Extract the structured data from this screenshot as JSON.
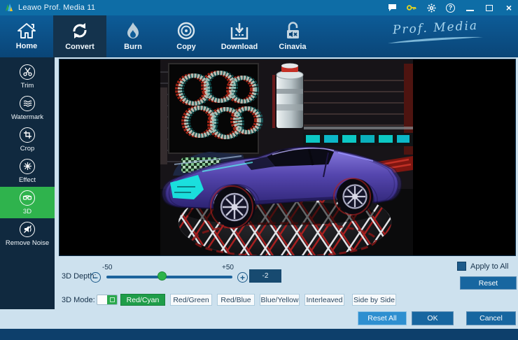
{
  "window": {
    "title": "Leawo Prof. Media 11"
  },
  "titlebar": {
    "icons": [
      "comment-icon",
      "key-icon",
      "gear-icon",
      "help-icon",
      "minimize-icon",
      "maximize-icon",
      "close-icon"
    ],
    "help_glyph": "?",
    "close_glyph": "×"
  },
  "nav": {
    "tabs": [
      {
        "label": "Home",
        "icon": "home-icon"
      },
      {
        "label": "Convert",
        "icon": "convert-icon"
      },
      {
        "label": "Burn",
        "icon": "burn-icon"
      },
      {
        "label": "Copy",
        "icon": "copy-icon"
      },
      {
        "label": "Download",
        "icon": "download-icon"
      },
      {
        "label": "Cinavia",
        "icon": "cinavia-icon"
      }
    ],
    "active_tab": "Convert",
    "brand_script": "Prof. Media"
  },
  "sidebar": {
    "items": [
      {
        "label": "Trim",
        "icon": "scissors-icon"
      },
      {
        "label": "Watermark",
        "icon": "waves-icon"
      },
      {
        "label": "Crop",
        "icon": "crop-icon"
      },
      {
        "label": "Effect",
        "icon": "sparkle-icon"
      },
      {
        "label": "3D",
        "icon": "3d-glasses-icon"
      },
      {
        "label": "Remove Noise",
        "icon": "noise-off-icon"
      }
    ],
    "active_item": "3D"
  },
  "preview": {
    "content": "anaglyph 3D video frame of a purple sports car in a sci-fi garage with ring display, tank and grid floor"
  },
  "depth_control": {
    "label": "3D Depth:",
    "min_label": "-50",
    "max_label": "+50",
    "value": "-2",
    "slider_min": -50,
    "slider_max": 50,
    "slider_value": -2,
    "minus_glyph": "−",
    "plus_glyph": "+"
  },
  "mode_control": {
    "label": "3D Mode:",
    "enabled": true,
    "options": [
      "Red/Cyan",
      "Red/Green",
      "Red/Blue",
      "Blue/Yellow",
      "Interleaved",
      "Side by Side"
    ],
    "selected": "Red/Cyan"
  },
  "apply_to_all": {
    "label": "Apply to All",
    "checked": true
  },
  "buttons": {
    "reset": "Reset",
    "reset_all": "Reset All",
    "ok": "OK",
    "cancel": "Cancel"
  },
  "colors": {
    "titlebar": "#0e6da6",
    "nav_top": "#0d5c98",
    "nav_bottom": "#0a4577",
    "active_tab_bg": "#14334d",
    "sidebar_bg": "#10293f",
    "accent_green": "#2fb34d",
    "panel_bg": "#cde1ee",
    "button_blue": "#1766a0",
    "button_light_blue": "#2e8fd0",
    "value_box": "#174a70",
    "footer": "#0d3f6b",
    "key_icon": "#e5d51f"
  }
}
